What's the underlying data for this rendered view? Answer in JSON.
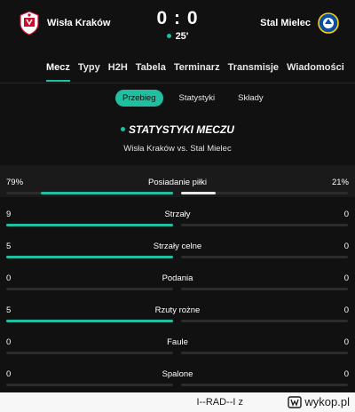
{
  "match": {
    "home_team": "Wisła Kraków",
    "away_team": "Stal Mielec",
    "score": "0 : 0",
    "minute": "25'",
    "accent_color": "#1fbf9f"
  },
  "tabs": [
    "Mecz",
    "Typy",
    "H2H",
    "Tabela",
    "Terminarz",
    "Transmisje",
    "Wiadomości"
  ],
  "active_tab": "Mecz",
  "subtabs": [
    "Przebieg",
    "Statystyki",
    "Składy"
  ],
  "active_subtab": "Przebieg",
  "section": {
    "title": "STATYSTYKI MECZU",
    "subtitle": "Wisła Kraków vs. Stal Mielec"
  },
  "stats": [
    {
      "name": "Posiadanie piłki",
      "home": "79%",
      "away": "21%",
      "home_share": 0.79,
      "away_share": 0.21
    },
    {
      "name": "Strzały",
      "home": "9",
      "away": "0",
      "home_share": 1.0,
      "away_share": 0.0
    },
    {
      "name": "Strzały celne",
      "home": "5",
      "away": "0",
      "home_share": 1.0,
      "away_share": 0.0
    },
    {
      "name": "Podania",
      "home": "0",
      "away": "0",
      "home_share": 0.0,
      "away_share": 0.0
    },
    {
      "name": "Rzuty rożne",
      "home": "5",
      "away": "0",
      "home_share": 1.0,
      "away_share": 0.0
    },
    {
      "name": "Faule",
      "home": "0",
      "away": "0",
      "home_share": 0.0,
      "away_share": 0.0
    },
    {
      "name": "Spalone",
      "home": "0",
      "away": "0",
      "home_share": 0.0,
      "away_share": 0.0
    }
  ],
  "footer": {
    "user": "I--RAD--I",
    "separator": "z",
    "brand": "wykop.pl"
  }
}
